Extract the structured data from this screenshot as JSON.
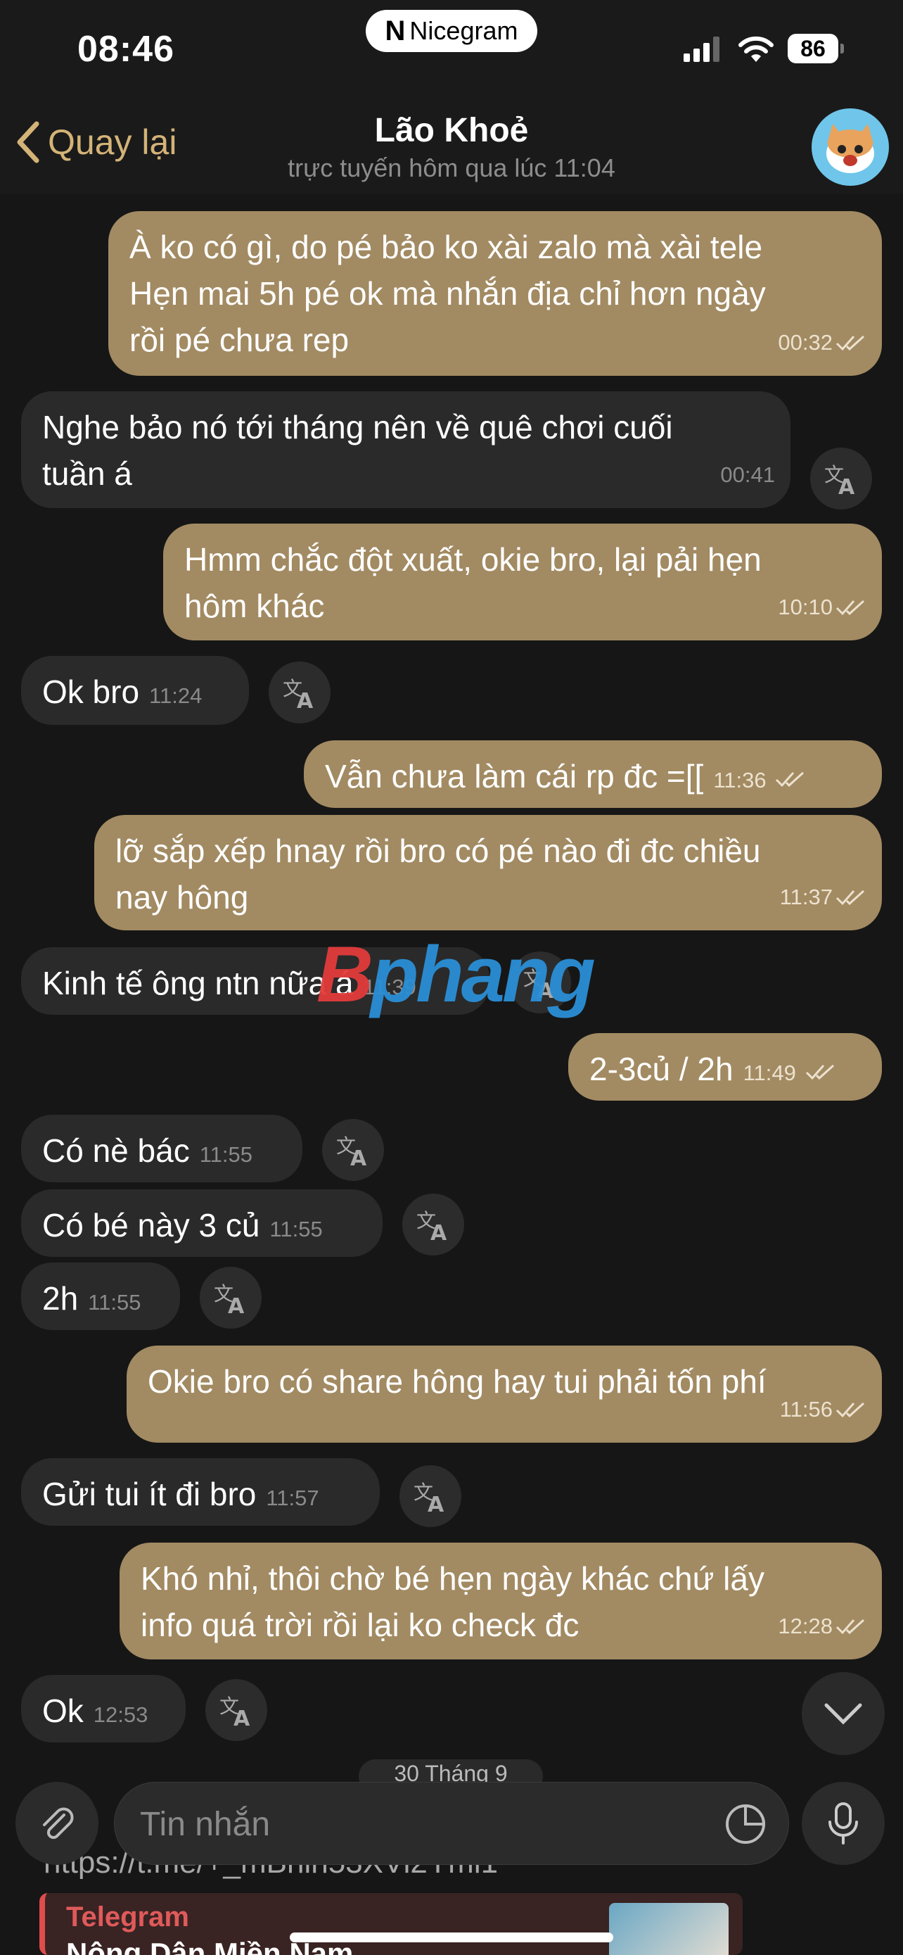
{
  "status": {
    "time": "08:46",
    "app_pill": "Nicegram",
    "battery": "86"
  },
  "header": {
    "back_label": "Quay lại",
    "title": "Lão Khoẻ",
    "subtitle": "trực tuyến hôm qua lúc 11:04"
  },
  "messages": [
    {
      "dir": "out",
      "lines": [
        "À ko có gì, do pé bảo ko xài zalo mà xài tele",
        "Hẹn mai 5h pé ok mà nhắn địa chỉ hơn ngày",
        "rồi pé chưa rep"
      ],
      "time": "00:32"
    },
    {
      "dir": "in",
      "lines": [
        "Nghe bảo nó tới tháng nên về quê chơi cuối",
        "tuần á"
      ],
      "time": "00:41"
    },
    {
      "dir": "out",
      "lines": [
        "Hmm chắc đột xuất, okie bro, lại pải hẹn",
        "hôm khác"
      ],
      "time": "10:10"
    },
    {
      "dir": "in",
      "text": "Ok bro",
      "time": "11:24"
    },
    {
      "dir": "out",
      "text": "Vẫn chưa làm cái rp đc =[[",
      "time": "11:36"
    },
    {
      "dir": "out",
      "lines": [
        "lỡ sắp xếp hnay rồi bro có pé nào đi đc chiều",
        "nay hông"
      ],
      "time": "11:37"
    },
    {
      "dir": "in",
      "text": "Kinh tế ông ntn nữa á",
      "time": "11:39"
    },
    {
      "dir": "out",
      "text": "2-3củ / 2h",
      "time": "11:49"
    },
    {
      "dir": "in",
      "text": "Có nè bác",
      "time": "11:55"
    },
    {
      "dir": "in",
      "text": "Có bé này 3 củ",
      "time": "11:55"
    },
    {
      "dir": "in",
      "text": "2h",
      "time": "11:55"
    },
    {
      "dir": "out",
      "lines": [
        "Okie bro có share hông hay tui phải tốn phí"
      ],
      "time": "11:56"
    },
    {
      "dir": "in",
      "text": "Gửi tui ít đi bro",
      "time": "11:57"
    },
    {
      "dir": "out",
      "lines": [
        "Khó nhỉ, thôi chờ bé hẹn ngày khác chứ lấy",
        "info quá trời rồi lại ko check đc"
      ],
      "time": "12:28"
    },
    {
      "dir": "in",
      "text": "Ok",
      "time": "12:53"
    }
  ],
  "watermark": {
    "a": "B",
    "b": "phang"
  },
  "date_separator": "30 Tháng 9",
  "composer": {
    "placeholder": "Tin nhắn"
  },
  "link_preview": {
    "url": "https://t.me/+_mBhih53XVi2Yml1",
    "site": "Telegram",
    "name": "Nông Dân Miền Nam"
  },
  "icons": [
    "chevron-left-icon",
    "translate-icon",
    "read-check-icon",
    "attach-icon",
    "sticker-icon",
    "mic-icon",
    "chevron-down-icon"
  ],
  "colors": {
    "outgoing_bubble": "#a28a62",
    "incoming_bubble": "#2a2a2a",
    "accent": "#d4b377",
    "background": "#161616"
  }
}
